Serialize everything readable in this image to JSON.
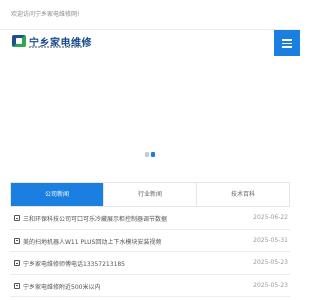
{
  "topbar": {
    "welcome": "欢迎访问宁乡家电维修网!"
  },
  "header": {
    "logo_text": "宁乡家电维修"
  },
  "menu": {
    "icon": "hamburger-icon"
  },
  "banner": {
    "active_slide": 2,
    "slide_count": 2
  },
  "tabs": [
    {
      "label": "公司新闻",
      "active": true
    },
    {
      "label": "行业新闻",
      "active": false
    },
    {
      "label": "技术百科",
      "active": false
    }
  ],
  "news": [
    {
      "title": "三和环保科技公司可口可乐冷藏展示柜控制器调节数据",
      "date": "2025-06-22"
    },
    {
      "title": "美的扫地机器人W11 PLUS回动上下水模块安装视频",
      "date": "2025-05-31"
    },
    {
      "title": "宁乡家电维修师傅电话13357213185",
      "date": "2025-05-23"
    },
    {
      "title": "宁乡家电维修附近500米以内",
      "date": "2025-05-23"
    }
  ],
  "colors": {
    "accent": "#1a7fe0",
    "logo_blue": "#174a8c",
    "logo_green": "#2fa84f"
  }
}
